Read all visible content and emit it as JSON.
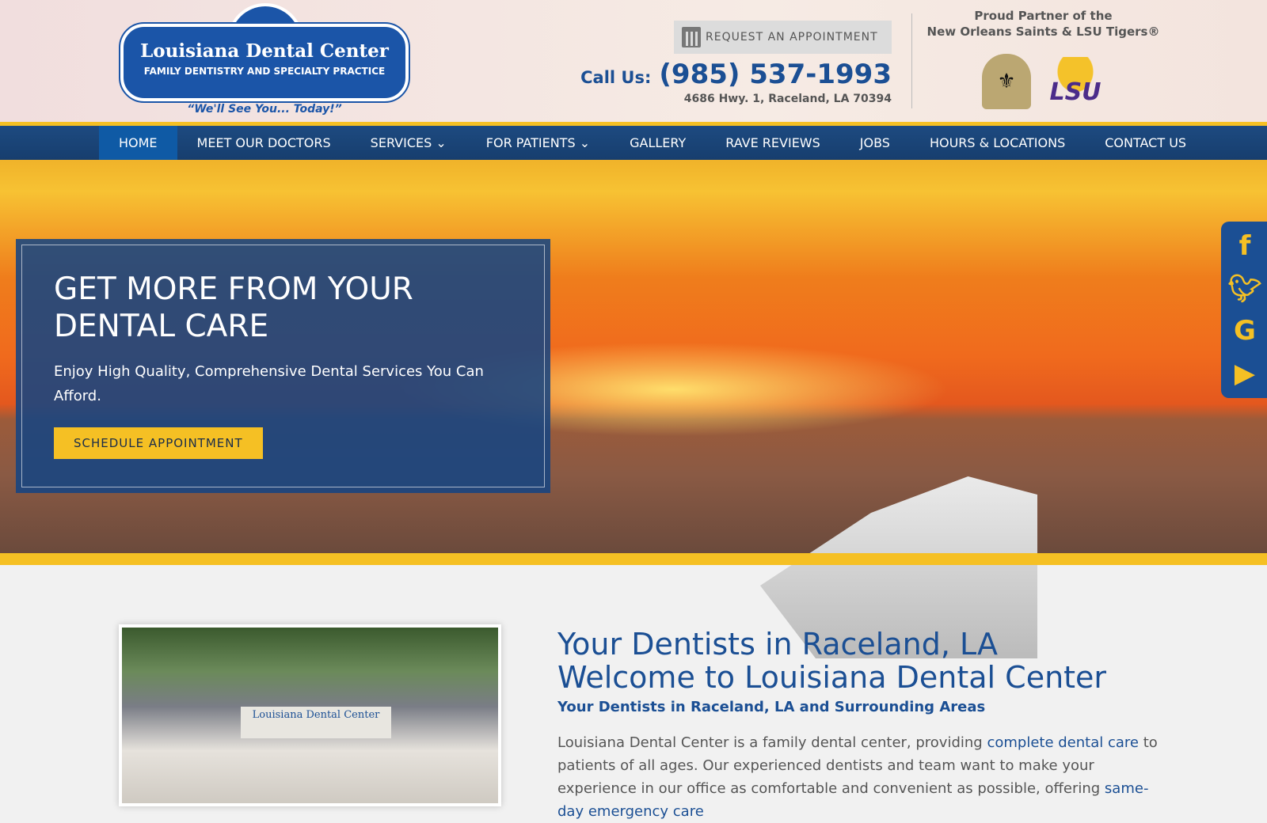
{
  "header": {
    "logo": {
      "name": "Louisiana Dental Center",
      "subtitle": "FAMILY DENTISTRY AND SPECIALTY PRACTICE",
      "tagline": "“We'll See You... Today!”"
    },
    "request_appointment": "REQUEST AN APPOINTMENT",
    "call_label": "Call Us:",
    "phone": "(985) 537-1993",
    "address": "4686 Hwy. 1, Raceland, LA 70394",
    "partner_line1": "Proud Partner of the",
    "partner_line2": "New Orleans Saints & LSU Tigers®",
    "lsu_logo": "LSU"
  },
  "nav": {
    "items": [
      "HOME",
      "MEET OUR DOCTORS",
      "SERVICES ⌄",
      "FOR PATIENTS ⌄",
      "GALLERY",
      "RAVE REVIEWS",
      "JOBS",
      "HOURS & LOCATIONS",
      "CONTACT US"
    ],
    "active": "HOME"
  },
  "hero": {
    "title": "GET MORE FROM YOUR DENTAL CARE",
    "text": "Enjoy High Quality, Comprehensive Dental Services You Can Afford.",
    "button": "SCHEDULE APPOINTMENT"
  },
  "social": [
    "facebook-icon",
    "twitter-icon",
    "google-icon",
    "youtube-icon"
  ],
  "main": {
    "title1": "Your Dentists in Raceland, LA",
    "title2": "Welcome to Louisiana Dental Center",
    "subtitle": "Your Dentists in Raceland, LA and Surrounding Areas",
    "p_a": "Louisiana Dental Center is a family dental center, providing ",
    "link1": "complete dental care",
    "p_b": " to patients of all ages. Our experienced dentists and team want to make your experience in our office as comfortable and convenient as possible, offering ",
    "link2": "same-day emergency care",
    "photo_sign": "Louisiana Dental Center"
  },
  "colors": {
    "brand_blue": "#1b4f94",
    "accent_yellow": "#f5c024"
  }
}
